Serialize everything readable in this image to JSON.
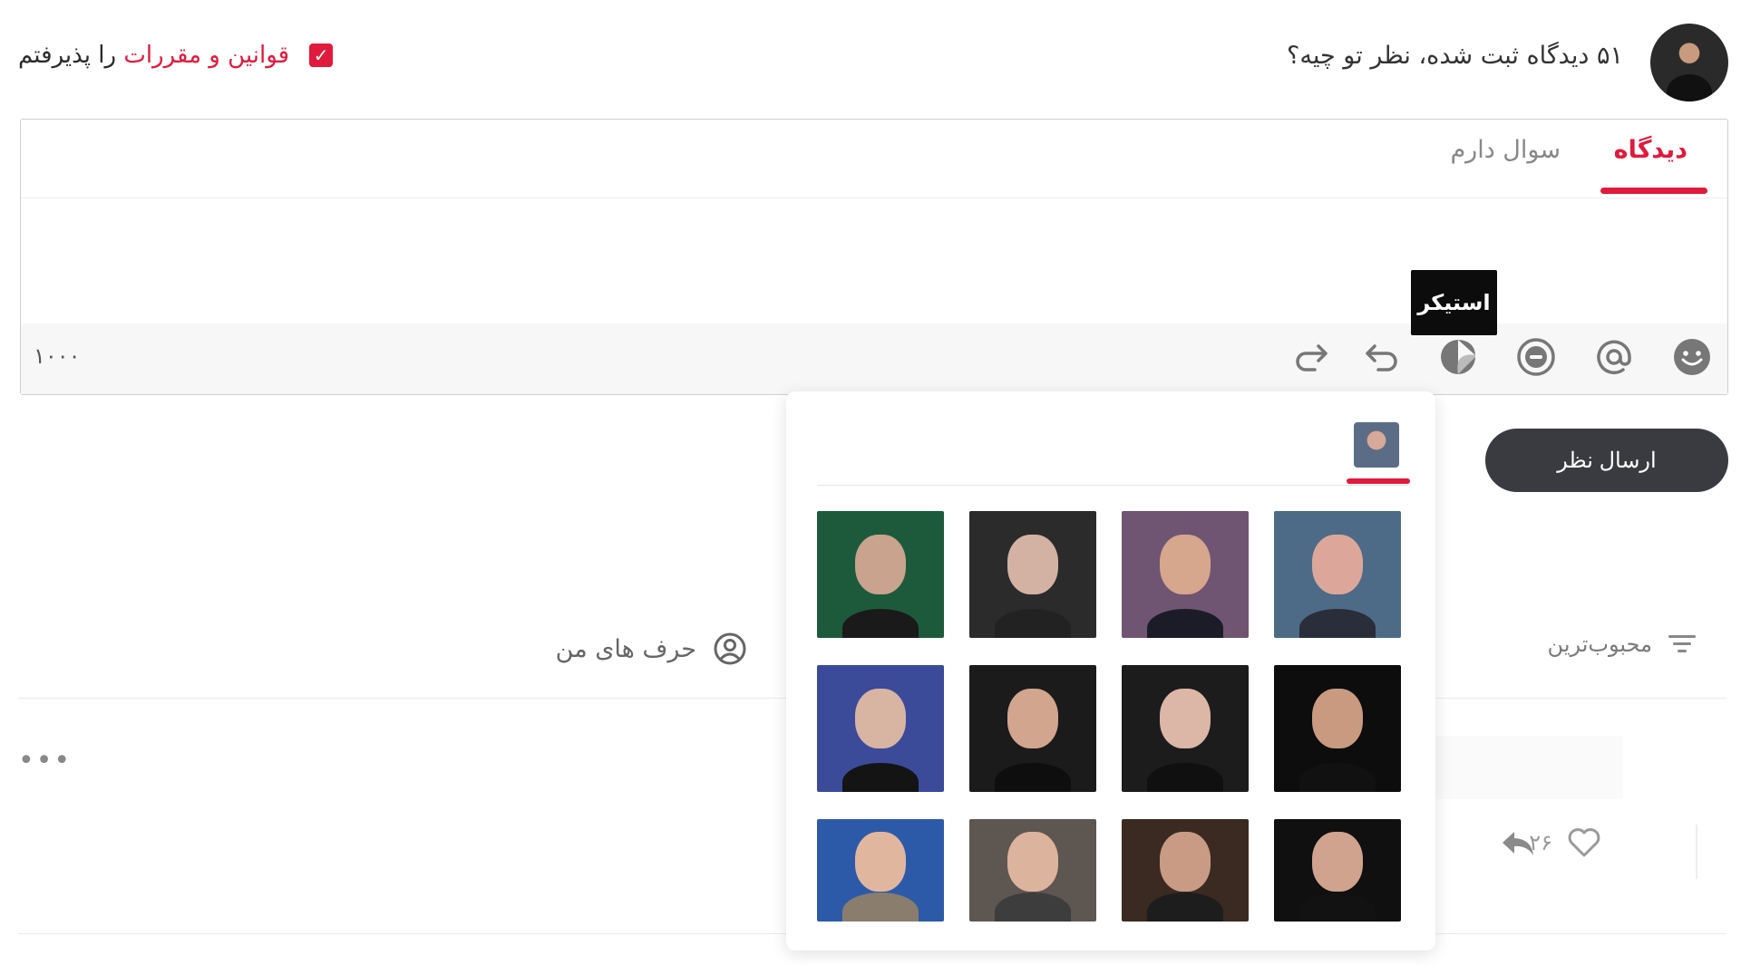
{
  "header": {
    "title": "۵۱ دیدگاه ثبت شده، نظر تو چیه؟",
    "accept_prefix": "قوانین و مقررات",
    "accept_suffix": " را پذیرفتم",
    "checkbox_mark": "✓",
    "accepted": true
  },
  "editor": {
    "tabs": [
      {
        "label": "دیدگاه",
        "active": true
      },
      {
        "label": "سوال دارم",
        "active": false
      }
    ],
    "counter": "۱۰۰۰",
    "tooltip": "استیکر",
    "toolbar_icons": [
      "emoji-icon",
      "mention-icon",
      "spoiler-icon",
      "sticker-icon",
      "undo-icon",
      "redo-icon"
    ]
  },
  "send_button": "ارسال نظر",
  "filters": {
    "sort_label": "محبوب‌ترین",
    "my_comments": "حرف های من"
  },
  "comment": {
    "more": "•••",
    "likes": "۲۶"
  },
  "sticker_panel": {
    "stickers": [
      {
        "name": "sticker-1",
        "bg": "#1d5a3b",
        "skin": "#c9a38e",
        "shirt": "#1a1a1a"
      },
      {
        "name": "sticker-2",
        "bg": "#2b2b2b",
        "skin": "#d4b2a3",
        "shirt": "#222222"
      },
      {
        "name": "sticker-3",
        "bg": "#6f5572",
        "skin": "#d6a68d",
        "shirt": "#1c1c28"
      },
      {
        "name": "sticker-4",
        "bg": "#4d6b86",
        "skin": "#dca79a",
        "shirt": "#2a2e3a"
      },
      {
        "name": "sticker-5",
        "bg": "#3c4a9a",
        "skin": "#d8b4a2",
        "shirt": "#141414"
      },
      {
        "name": "sticker-6",
        "bg": "#1b1b1b",
        "skin": "#d2a58f",
        "shirt": "#0e0e0e"
      },
      {
        "name": "sticker-7",
        "bg": "#1c1c1c",
        "skin": "#dcb6a6",
        "shirt": "#101010"
      },
      {
        "name": "sticker-8",
        "bg": "#0d0d0d",
        "skin": "#c99a80",
        "shirt": "#111111"
      },
      {
        "name": "sticker-9",
        "bg": "#2d5aa8",
        "skin": "#e0b79e",
        "shirt": "#8a7d6e"
      },
      {
        "name": "sticker-10",
        "bg": "#5e5650",
        "skin": "#dcb39c",
        "shirt": "#3d3d3d"
      },
      {
        "name": "sticker-11",
        "bg": "#3b2a22",
        "skin": "#c99b85",
        "shirt": "#1d1d1d"
      },
      {
        "name": "sticker-12",
        "bg": "#101010",
        "skin": "#cfa38e",
        "shirt": "#121212"
      }
    ]
  }
}
